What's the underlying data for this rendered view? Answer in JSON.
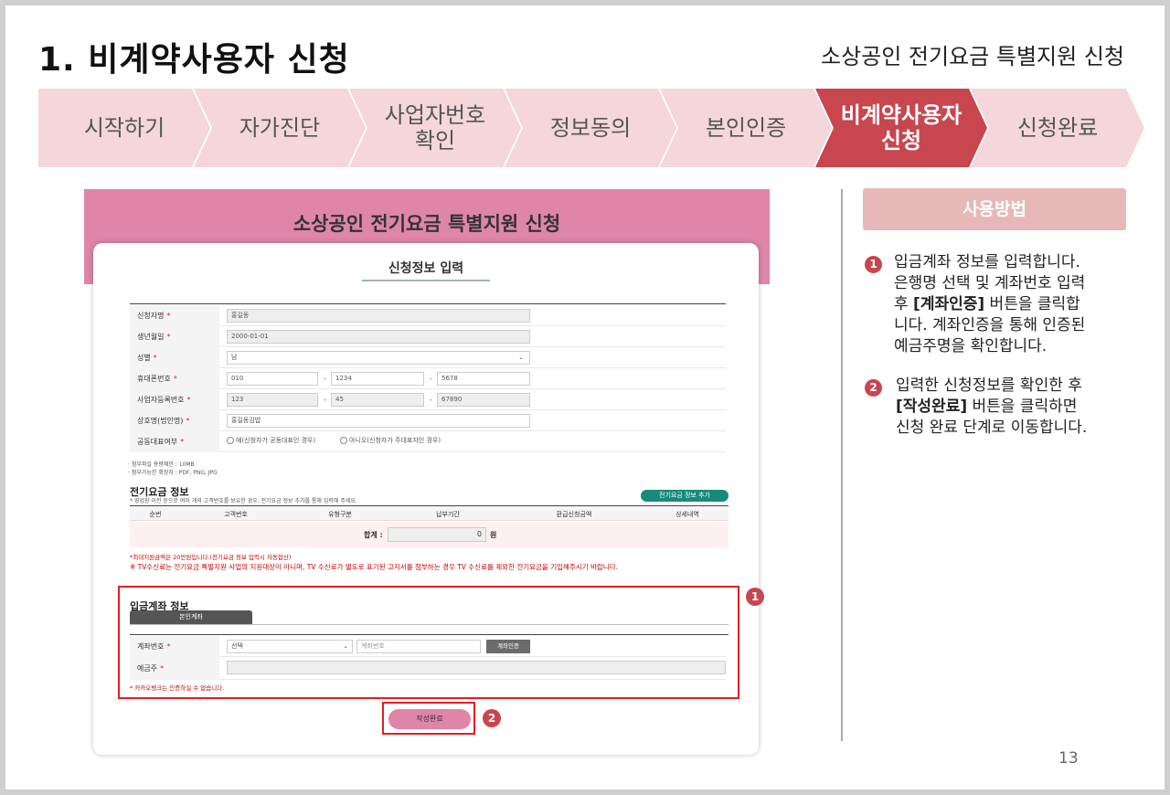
{
  "title": "1. 비계약사용자 신청",
  "subtitle": "소상공인 전기요금 특별지원 신청",
  "steps": [
    {
      "label": "시작하기"
    },
    {
      "label": "자가진단"
    },
    {
      "label": "사업자번호\n확인"
    },
    {
      "label": "정보동의"
    },
    {
      "label": "본인인증"
    },
    {
      "label": "비계약사용자\n신청"
    },
    {
      "label": "신청완료"
    }
  ],
  "screenshot": {
    "header_title": "소상공인 전기요금 특별지원 신청",
    "card_title": "신청정보 입력",
    "applicant": {
      "name_label": "신청자명",
      "name_value": "홍길동",
      "birth_label": "생년월일",
      "birth_value": "2000-01-01",
      "gender_label": "성별",
      "gender_value": "남",
      "phone_label": "휴대폰번호",
      "phone_1": "010",
      "phone_2": "1234",
      "phone_3": "5678",
      "bizno_label": "사업자등록번호",
      "bizno_1": "123",
      "bizno_2": "45",
      "bizno_3": "67890",
      "company_label": "상호명(법인명)",
      "company_value": "홍길동김밥",
      "rep_label": "공동대표여부",
      "rep_yes": "예(신청자가 공동대표인 경우)",
      "rep_no": "아니오(신청자가 주대표자인 경우)",
      "req_mark": "*",
      "dash": "-"
    },
    "file_note_1": "· 첨부파일 용량제한 : 10MB",
    "file_note_2": "· 첨부가능한 확장자 : PDF, PNG, JPG",
    "elec": {
      "title": "전기요금 정보",
      "desc": "* 영업장 이전 등으로 여러 개의 고객번호를 보유한 경우, 전기요금 정보 추가를 통해 입력해 주세요.",
      "add_button": "전기요금 정보 추가",
      "columns": [
        "순번",
        "고객번호",
        "유형구분",
        "납부기간",
        "환급신청금액",
        "상세내역"
      ],
      "total_label": "합계 :",
      "total_value": "0",
      "total_unit": "원",
      "note_max": "*최대지원금액은 20만원입니다.(전기요금 정보 입력시 자동합산)",
      "note_tv": "※ TV수신료는 전기요금 특별지원 사업의 지원대상이 아니며, TV 수신료가 별도로 표기된 고지서를 첨부하는 경우 TV 수신료를 제외한 전기요금을 기입해주시기 바랍니다."
    },
    "account": {
      "title": "입금계좌 정보",
      "tab": "본인계좌",
      "acct_label": "계좌번호",
      "bank_select": "선택",
      "acct_placeholder": "계좌번호",
      "verify_button": "계좌인증",
      "holder_label": "예금주",
      "note": "* 카카오뱅크는 인증하실 수 없습니다."
    },
    "submit_button": "작성완료",
    "badge_1": "1",
    "badge_2": "2"
  },
  "howto": {
    "title": "사용방법",
    "item1_badge": "1",
    "item1_line1": "입금계좌 정보를 입력합니다.",
    "item1_line2": "은행명 선택 및 계좌번호 입력",
    "item1_line3_pre": "후 ",
    "item1_line3_bold": "[계좌인증]",
    "item1_line3_post": " 버튼을 클릭합",
    "item1_line4": "니다. 계좌인증을 통해 인증된",
    "item1_line5": "예금주명을 확인합니다.",
    "item2_badge": "2",
    "item2_line1": "입력한 신청정보를 확인한 후",
    "item2_line2_bold": "[작성완료]",
    "item2_line2_post": " 버튼을 클릭하면",
    "item2_line3": "신청 완료 단계로 이동합니다."
  },
  "page_number": "13"
}
